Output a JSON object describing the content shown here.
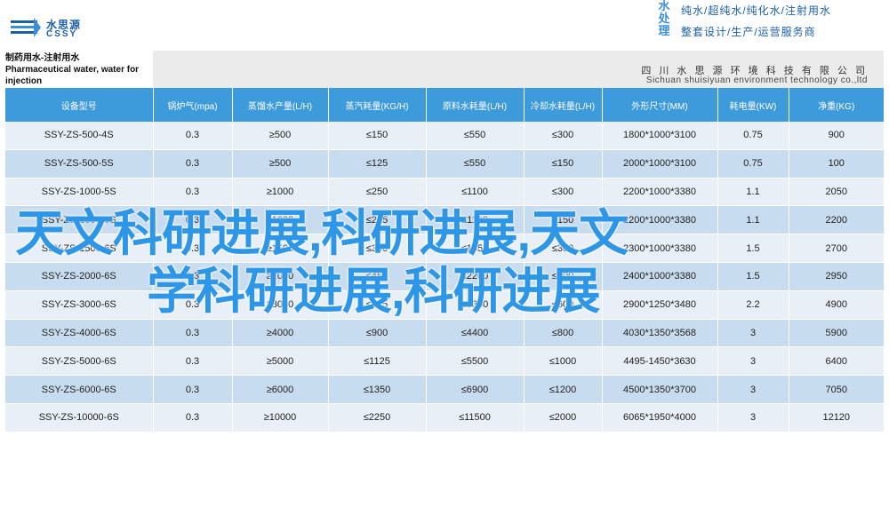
{
  "header": {
    "logo_cn": "水思源",
    "logo_en": "CSSY",
    "brand_vertical": [
      "水",
      "处",
      "理"
    ],
    "brand_line1": "纯水/超纯水/纯化水/注射用水",
    "brand_line2": "整套设计/生产/运营服务商",
    "title_line1": "制药用水-注射用水",
    "title_line2": "Pharmaceutical water, water for",
    "title_line3": "injection",
    "company_cn": "四 川 水 思 源 环 境 科 技 有 限 公 司",
    "company_en": "Sichuan shuisiyuan environment technology co.,ltd"
  },
  "table": {
    "headers": [
      "设备型号",
      "锅炉气(mpa)",
      "蒸馏水产量(L/H)",
      "蒸汽耗量(KG/H)",
      "原料水耗量(L/H)",
      "冷却水耗量(L/H)",
      "外形尺寸(MM)",
      "耗电量(KW)",
      "净重(KG)"
    ],
    "rows": [
      [
        "SSY-ZS-500-4S",
        "0.3",
        "≥500",
        "≤150",
        "≤550",
        "≤300",
        "1800*1000*3100",
        "0.75",
        "900"
      ],
      [
        "SSY-ZS-500-5S",
        "0.3",
        "≥500",
        "≤125",
        "≤550",
        "≤150",
        "2000*1000*3100",
        "0.75",
        "100"
      ],
      [
        "SSY-ZS-1000-5S",
        "0.3",
        "≥1000",
        "≤250",
        "≤1100",
        "≤300",
        "2200*1000*3380",
        "1.1",
        "2050"
      ],
      [
        "SSY-ZS-1000-6S",
        "0.3",
        "≥1000",
        "≤225",
        "≤1100",
        "≤150",
        "2200*1000*3380",
        "1.1",
        "2200"
      ],
      [
        "SSY-ZS-1500-6S",
        "0.3",
        "≥1500",
        "≤340",
        "≤1650",
        "≤300",
        "2300*1000*3380",
        "1.5",
        "2700"
      ],
      [
        "SSY-ZS-2000-6S",
        "0.3",
        "≥2000",
        "≤450",
        "≤2200",
        "≤400",
        "2400*1000*3380",
        "1.5",
        "2950"
      ],
      [
        "SSY-ZS-3000-6S",
        "0.3",
        "≥3000",
        "≤675",
        "≤3300",
        "≤600",
        "2900*1250*3480",
        "2.2",
        "4900"
      ],
      [
        "SSY-ZS-4000-6S",
        "0.3",
        "≥4000",
        "≤900",
        "≤4400",
        "≤800",
        "4030*1350*3568",
        "3",
        "5900"
      ],
      [
        "SSY-ZS-5000-6S",
        "0.3",
        "≥5000",
        "≤1125",
        "≤5500",
        "≤1000",
        "4495-1450*3630",
        "3",
        "6400"
      ],
      [
        "SSY-ZS-6000-6S",
        "0.3",
        "≥6000",
        "≤1350",
        "≤6900",
        "≤1200",
        "4500*1350*3700",
        "3",
        "7050"
      ],
      [
        "SSY-ZS-10000-6S",
        "0.3",
        "≥10000",
        "≤2250",
        "≤11500",
        "≤2000",
        "6065*1950*4000",
        "3",
        "12120"
      ]
    ]
  },
  "overlay": {
    "line1": "天文科研进展,科研进展,天文",
    "line2": "学科研进展,科研进展"
  },
  "colors": {
    "header_blue": "#3d9adb",
    "row_light": "#e8eff7",
    "row_dark": "#c8dcef",
    "overlay_blue": "#2e96e6"
  }
}
